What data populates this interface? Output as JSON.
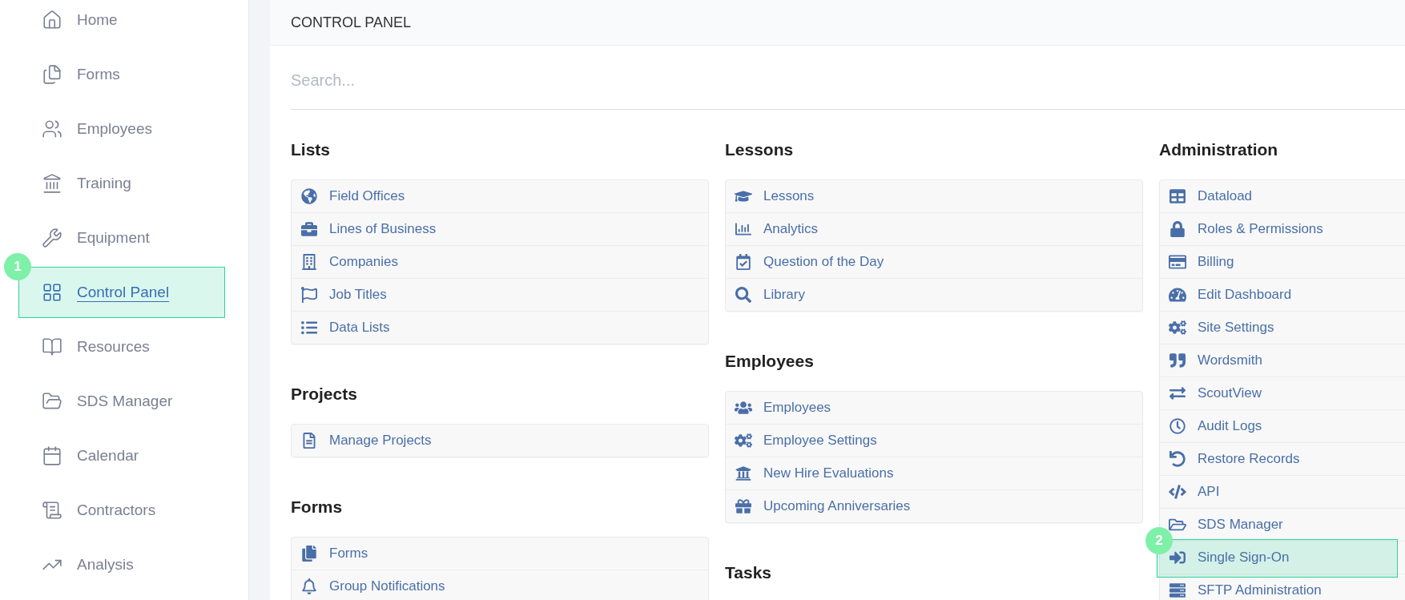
{
  "sidebar": {
    "items": [
      {
        "label": "Home",
        "selected": false
      },
      {
        "label": "Forms",
        "selected": false
      },
      {
        "label": "Employees",
        "selected": false
      },
      {
        "label": "Training",
        "selected": false
      },
      {
        "label": "Equipment",
        "selected": false
      },
      {
        "label": "Control Panel",
        "selected": true,
        "marker": "1"
      },
      {
        "label": "Resources",
        "selected": false
      },
      {
        "label": "SDS Manager",
        "selected": false
      },
      {
        "label": "Calendar",
        "selected": false
      },
      {
        "label": "Contractors",
        "selected": false
      },
      {
        "label": "Analysis",
        "selected": false
      }
    ]
  },
  "header": {
    "title": "CONTROL PANEL"
  },
  "search": {
    "placeholder": "Search..."
  },
  "columns": [
    {
      "sections": [
        {
          "title": "Lists",
          "items": [
            {
              "label": "Field Offices"
            },
            {
              "label": "Lines of Business"
            },
            {
              "label": "Companies"
            },
            {
              "label": "Job Titles"
            },
            {
              "label": "Data Lists"
            }
          ]
        },
        {
          "title": "Projects",
          "items": [
            {
              "label": "Manage Projects"
            }
          ]
        },
        {
          "title": "Forms",
          "items": [
            {
              "label": "Forms"
            },
            {
              "label": "Group Notifications"
            }
          ]
        }
      ]
    },
    {
      "sections": [
        {
          "title": "Lessons",
          "items": [
            {
              "label": "Lessons"
            },
            {
              "label": "Analytics"
            },
            {
              "label": "Question of the Day"
            },
            {
              "label": "Library"
            }
          ]
        },
        {
          "title": "Employees",
          "items": [
            {
              "label": "Employees"
            },
            {
              "label": "Employee Settings"
            },
            {
              "label": "New Hire Evaluations"
            },
            {
              "label": "Upcoming Anniversaries"
            }
          ]
        },
        {
          "title": "Tasks"
        }
      ]
    },
    {
      "sections": [
        {
          "title": "Administration",
          "items": [
            {
              "label": "Dataload"
            },
            {
              "label": "Roles & Permissions"
            },
            {
              "label": "Billing"
            },
            {
              "label": "Edit Dashboard"
            },
            {
              "label": "Site Settings"
            },
            {
              "label": "Wordsmith"
            },
            {
              "label": "ScoutView"
            },
            {
              "label": "Audit Logs"
            },
            {
              "label": "Restore Records"
            },
            {
              "label": "API"
            },
            {
              "label": "SDS Manager"
            },
            {
              "label": "Single Sign-On",
              "marker": "2"
            },
            {
              "label": "SFTP Administration"
            }
          ]
        }
      ]
    }
  ]
}
